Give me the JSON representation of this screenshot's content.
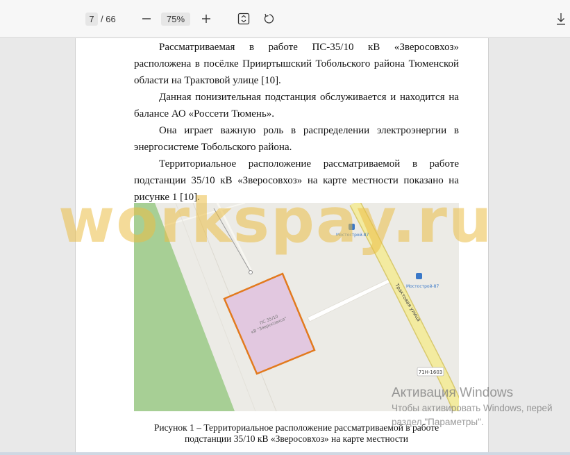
{
  "toolbar": {
    "current_page": "7",
    "total_pages": "/ 66",
    "zoom": "75%",
    "icons": [
      "minus-icon",
      "plus-icon",
      "fit-page-icon",
      "rotate-icon",
      "download-icon"
    ]
  },
  "document": {
    "paragraphs": [
      "Рассматриваемая в работе ПС-35/10 кВ «Зверосовхоз» расположена в посёлке Прииртышский Тобольского района Тюменской области на Трактовой улице [10].",
      "Данная понизительная подстанция обслуживается и находится на балансе АО «Россети Тюмень».",
      "Она играет важную роль в распределении электроэнергии в энергосистеме Тобольского района.",
      "Территориальное расположение рассматриваемой в работе подстанции 35/10 кВ «Зверосовхоз» на карте местности показано на рисунке 1 [10]."
    ],
    "caption_line1": "Рисунок 1 – Территориальное расположение рассматриваемой в работе",
    "caption_line2": "подстанции 35/10 кВ «Зверосовхоз» на карте местности"
  },
  "map": {
    "street_label": "Трактовая улица",
    "road_number": "71Н-1603",
    "substation_label_1": "ПС 35/10",
    "substation_label_2": "кВ \"Зверосовхоз\"",
    "poi_1": "Мостострой-87",
    "poi_2": "Мостострой-87",
    "colors": {
      "background": "#ecebe6",
      "forest": "#a7cf95",
      "road": "#f3eba0",
      "road_border": "#d8c96e",
      "substation_fill": "#e2c8e0",
      "substation_border": "#e27a1e",
      "poi": "#3a78c8"
    }
  },
  "watermark": "workspay.ru",
  "windows_activation": {
    "title": "Активация Windows",
    "line1": "Чтобы активировать Windows, перей",
    "line2": "раздел \"Параметры\"."
  }
}
